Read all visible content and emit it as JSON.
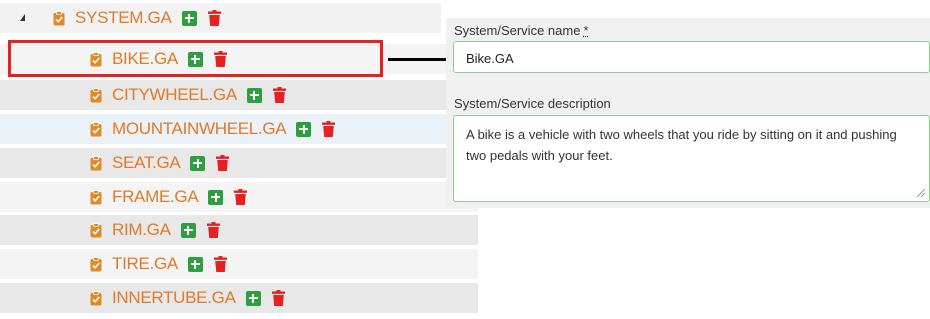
{
  "tree": {
    "root": {
      "label": "SYSTEM.GA"
    },
    "children": [
      {
        "label": "BIKE.GA"
      },
      {
        "label": "CITYWHEEL.GA"
      },
      {
        "label": "MOUNTAINWHEEL.GA"
      },
      {
        "label": "SEAT.GA"
      },
      {
        "label": "FRAME.GA"
      },
      {
        "label": "RIM.GA"
      },
      {
        "label": "TIRE.GA"
      },
      {
        "label": "INNERTUBE.GA"
      }
    ],
    "icons": {
      "node": "clipboard-check-icon",
      "add": "plus-square-icon",
      "delete": "trash-icon",
      "expand": "expanded-triangle-icon"
    },
    "colors": {
      "label": "#e07a2a",
      "add": "#2e9e3e",
      "delete": "#e52122",
      "selection": "#e52122"
    }
  },
  "form": {
    "name_label": "System/Service name",
    "required_mark": "*",
    "name_value": "Bike.GA",
    "description_label": "System/Service description",
    "description_value": "A bike is a vehicle with two wheels that you ride by sitting on it and pushing two pedals with your feet.",
    "colors": {
      "field_border": "#8fcf8f",
      "panel_bg": "#f0f0f0"
    }
  }
}
